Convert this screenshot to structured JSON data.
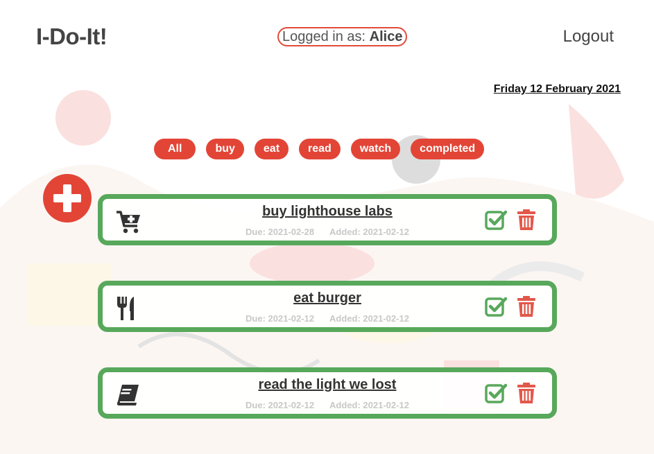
{
  "header": {
    "logo": "I-Do-It!",
    "logged_in_prefix": "Logged in as: ",
    "username": "Alice",
    "logout_label": "Logout"
  },
  "date": "Friday 12 February 2021",
  "filters": [
    "All",
    "buy",
    "eat",
    "read",
    "watch",
    "completed"
  ],
  "add_button_icon": "plus-icon",
  "tasks": [
    {
      "title": "buy lighthouse labs",
      "category": "buy",
      "icon": "cart-plus-icon",
      "due": "Due: 2021-02-28",
      "added": "Added: 2021-02-12"
    },
    {
      "title": "eat burger",
      "category": "eat",
      "icon": "utensils-icon",
      "due": "Due: 2021-02-12",
      "added": "Added: 2021-02-12"
    },
    {
      "title": "read the light we lost",
      "category": "read",
      "icon": "book-icon",
      "due": "Due: 2021-02-12",
      "added": "Added: 2021-02-12"
    }
  ],
  "colors": {
    "accent_red": "#e24536",
    "task_border_green": "#58a85b",
    "check_green": "#58a85b",
    "trash_red": "#e2584a"
  }
}
